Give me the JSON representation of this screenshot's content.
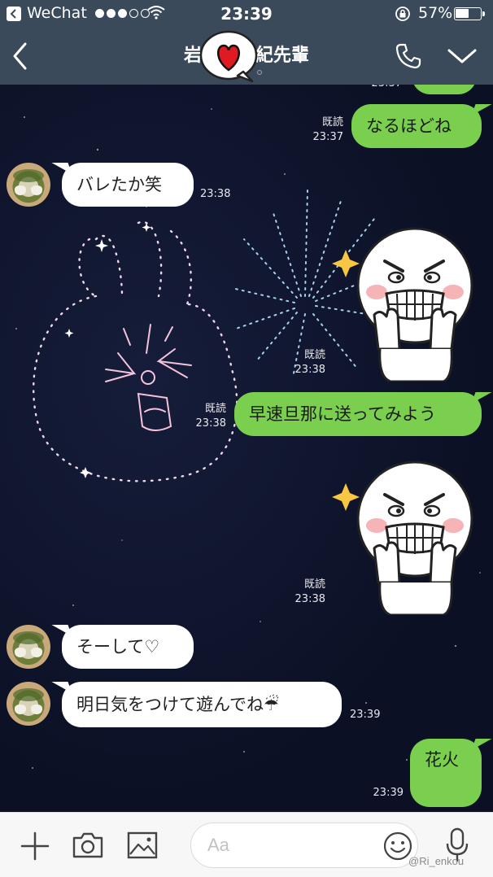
{
  "status_bar": {
    "carrier": "WeChat",
    "time": "23:39",
    "battery_percent": "57%",
    "battery_level": 0.57,
    "signal_dots_filled": 3,
    "signal_dots_total": 5
  },
  "header": {
    "title": "岩　　　紀先輩",
    "sticker_icon": "heart-speech-bubble-icon",
    "call_icon": "phone-icon",
    "menu_icon": "chevron-down-icon",
    "back_icon": "chevron-left-icon"
  },
  "messages": {
    "m0": {
      "read": "既読",
      "time": "23:37",
      "text": "なるほどね"
    },
    "m1": {
      "time": "23:38",
      "text": "バレたか笑"
    },
    "m2": {
      "read": "既読",
      "time": "23:38"
    },
    "m3": {
      "read": "既読",
      "time": "23:38",
      "text": "早速旦那に送ってみよう"
    },
    "m4": {
      "read": "既読",
      "time": "23:38"
    },
    "m5": {
      "text": "そーして♡"
    },
    "m6": {
      "time": "23:39",
      "text": "明日気をつけて遊んでね☔"
    },
    "m7": {
      "time": "23:39",
      "text": "花火"
    },
    "partial_time": "23:37"
  },
  "input_bar": {
    "placeholder": "Aa",
    "watermark": "@Ri_enkou",
    "icons": [
      "plus-icon",
      "camera-icon",
      "image-icon",
      "smiley-icon",
      "microphone-icon"
    ]
  },
  "colors": {
    "header_bg": "#3b4a5a",
    "chat_bg": "#0d1226",
    "outgoing_bubble": "#7ad04e",
    "incoming_bubble": "#ffffff"
  }
}
